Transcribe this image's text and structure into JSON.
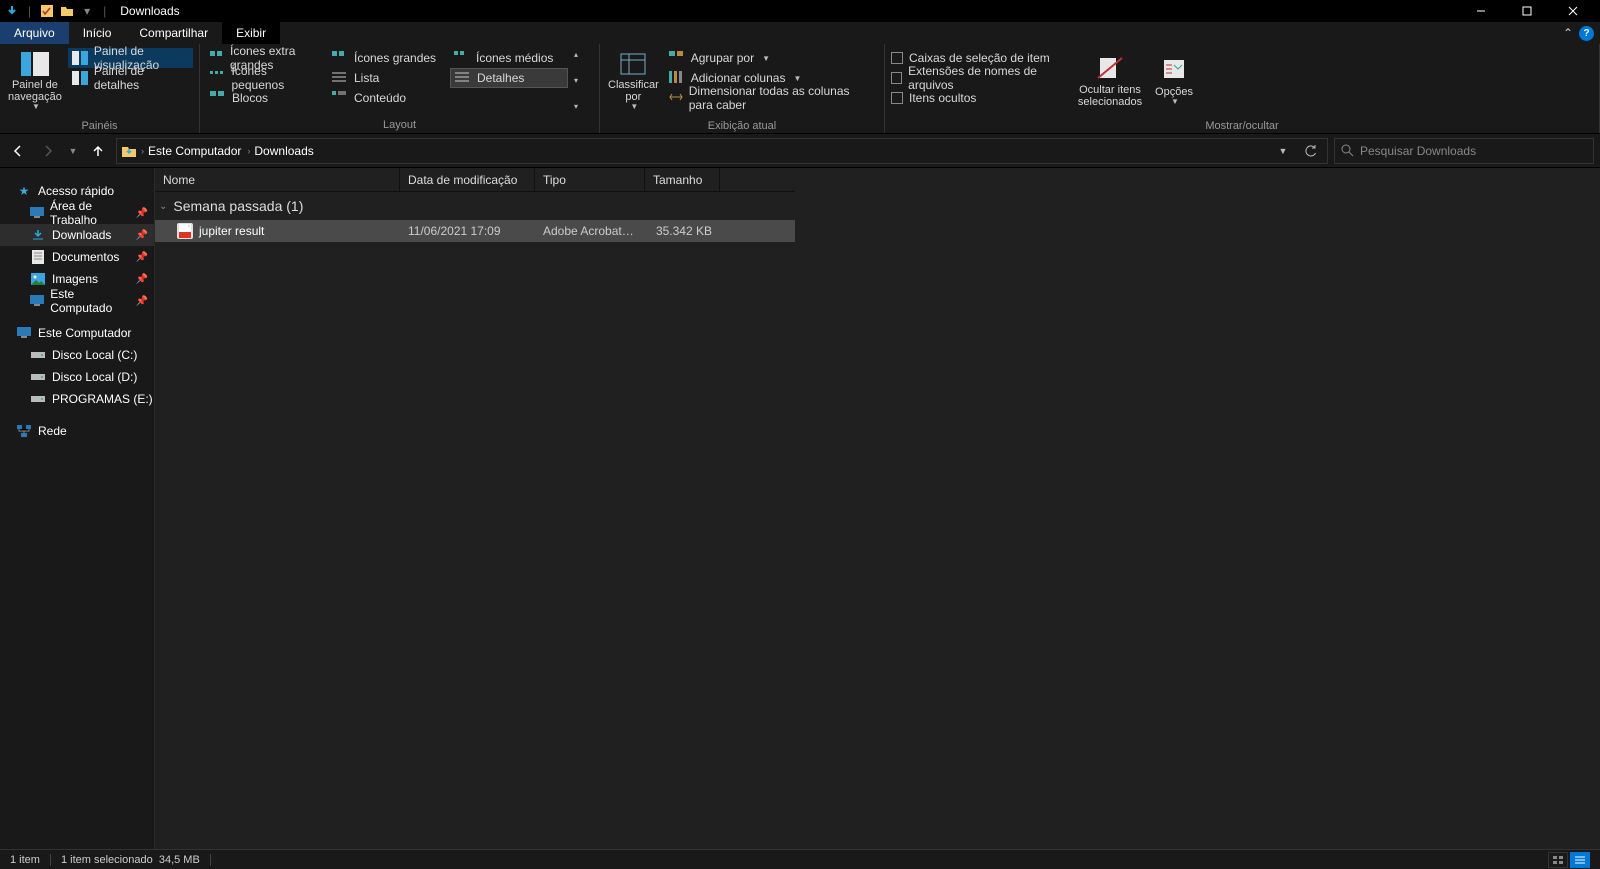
{
  "title_bar": {
    "title": "Downloads"
  },
  "menu": {
    "file": "Arquivo",
    "home": "Início",
    "share": "Compartilhar",
    "view": "Exibir"
  },
  "ribbon": {
    "panes_group": "Painéis",
    "nav_pane": "Painel de navegação",
    "preview_pane": "Painel de visualização",
    "details_pane": "Painel de detalhes",
    "layout_group": "Layout",
    "extra_large": "Ícones extra grandes",
    "large": "Ícones grandes",
    "medium": "Ícones médios",
    "small": "Ícones pequenos",
    "list": "Lista",
    "details": "Detalhes",
    "tiles": "Blocos",
    "content": "Conteúdo",
    "sort_by": "Classificar por",
    "group_by": "Agrupar por",
    "add_columns": "Adicionar colunas",
    "size_columns": "Dimensionar todas as colunas para caber",
    "current_view_group": "Exibição atual",
    "item_checkboxes": "Caixas de seleção de item",
    "file_ext": "Extensões de nomes de arquivos",
    "hidden_items": "Itens ocultos",
    "hide_selected": "Ocultar itens selecionados",
    "options": "Opções",
    "show_hide_group": "Mostrar/ocultar"
  },
  "nav": {
    "this_pc": "Este Computador",
    "downloads": "Downloads",
    "search_placeholder": "Pesquisar Downloads"
  },
  "side": {
    "quick_access": "Acesso rápido",
    "desktop": "Área de Trabalho",
    "downloads": "Downloads",
    "documents": "Documentos",
    "pictures": "Imagens",
    "this_pc_pinned": "Este Computado",
    "this_pc": "Este Computador",
    "disk_c": "Disco Local (C:)",
    "disk_d": "Disco Local (D:)",
    "programas": "PROGRAMAS (E:)",
    "network": "Rede"
  },
  "columns": {
    "name": "Nome",
    "date": "Data de modificação",
    "type": "Tipo",
    "size": "Tamanho"
  },
  "group_header": "Semana passada (1)",
  "files": [
    {
      "name": "jupiter result",
      "date": "11/06/2021 17:09",
      "type": "Adobe Acrobat D...",
      "size": "35.342 KB"
    }
  ],
  "status": {
    "count": "1 item",
    "selected": "1 item selecionado",
    "size": "34,5 MB"
  }
}
